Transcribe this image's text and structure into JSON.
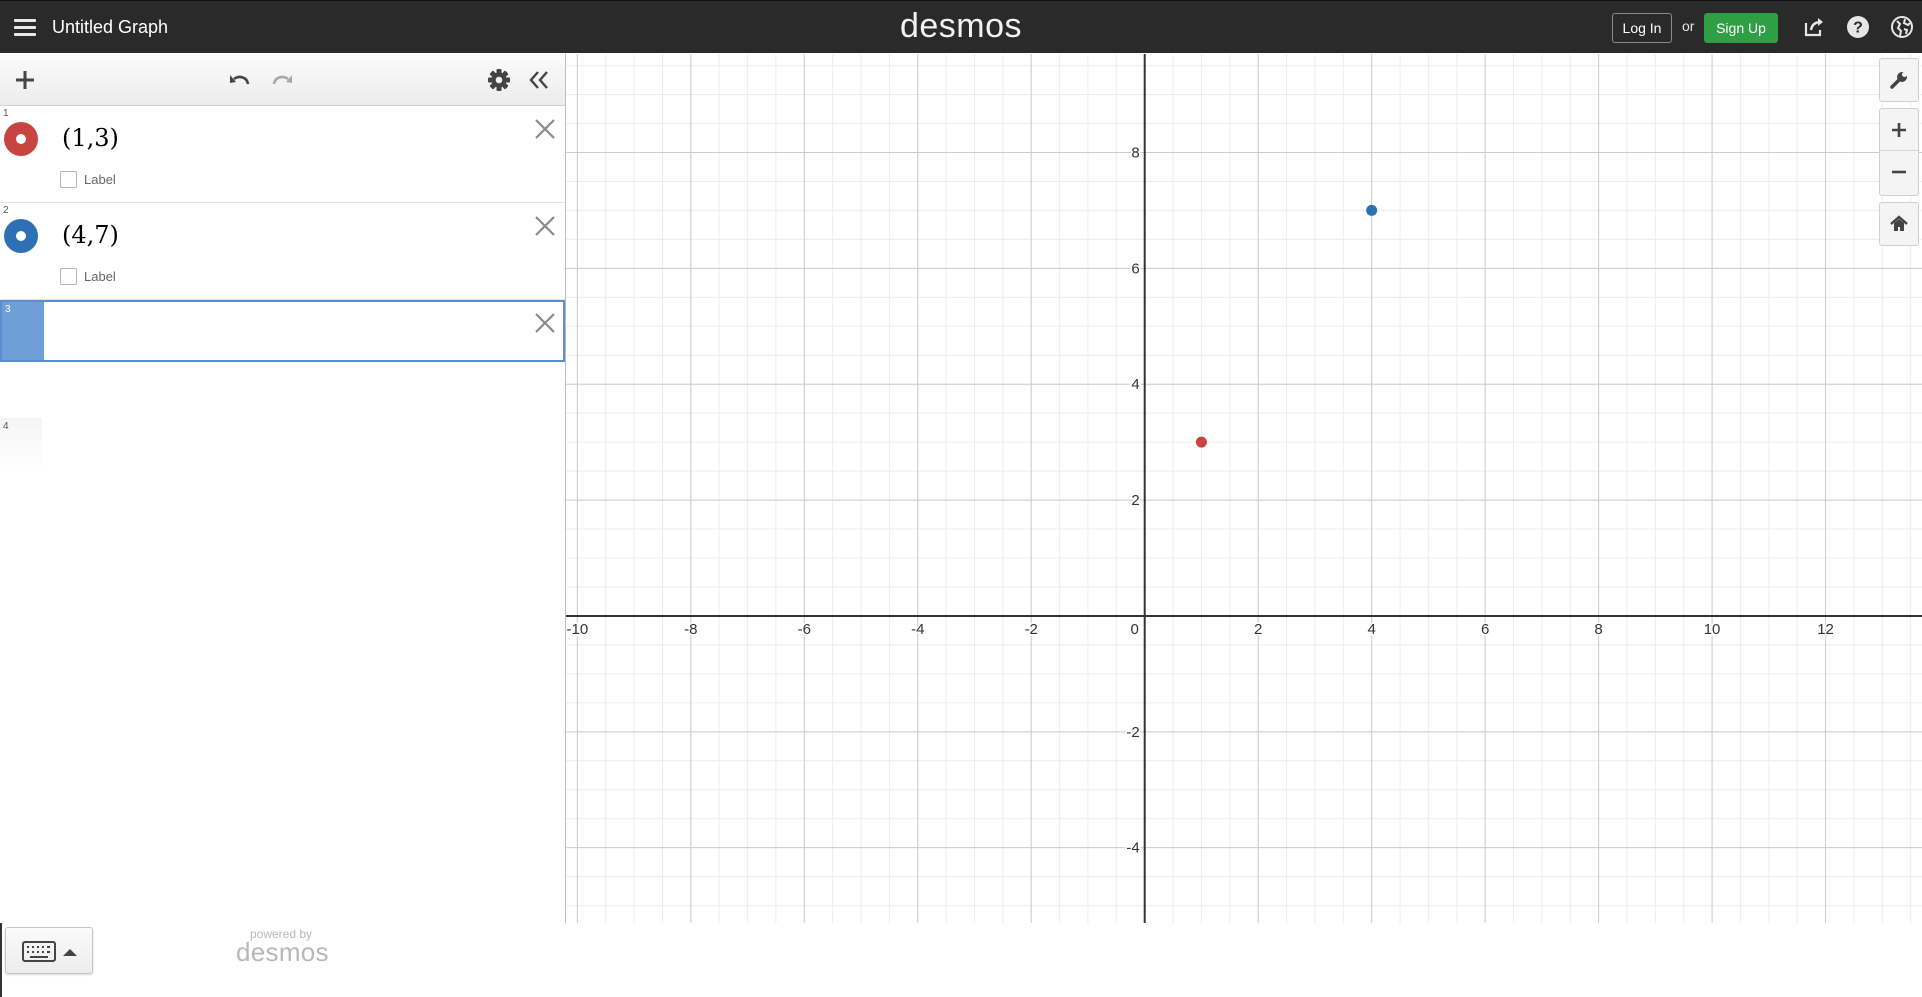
{
  "header": {
    "title": "Untitled Graph",
    "brand": "desmos",
    "login_label": "Log In",
    "or_label": "or",
    "signup_label": "Sign Up",
    "icons": [
      "menu-icon",
      "share-icon",
      "help-icon",
      "language-icon"
    ]
  },
  "expression_panel": {
    "toolbar_icons": [
      "add-icon",
      "undo-icon",
      "redo-icon",
      "settings-gear-icon",
      "collapse-panel-icon"
    ],
    "expressions": [
      {
        "index": "1",
        "latex": "(1,3)",
        "color": "#c74440",
        "label_text": "Label"
      },
      {
        "index": "2",
        "latex": "(4,7)",
        "color": "#2d70b3",
        "label_text": "Label"
      },
      {
        "index": "3",
        "latex": "",
        "active": true
      }
    ],
    "next_row_index": "4",
    "powered_by_small": "powered by",
    "powered_by_brand": "desmos"
  },
  "chart_data": {
    "type": "scatter",
    "xlim": [
      -10.2,
      13.7
    ],
    "ylim": [
      -5.3,
      9.7
    ],
    "x_ticks": [
      "-10",
      "-8",
      "-6",
      "-4",
      "-2",
      "0",
      "2",
      "4",
      "6",
      "8",
      "10",
      "12"
    ],
    "y_ticks": [
      "8",
      "6",
      "4",
      "2",
      "-2",
      "-4"
    ],
    "grid": true,
    "points": [
      {
        "x": 1,
        "y": 3,
        "color": "#c74440"
      },
      {
        "x": 4,
        "y": 7,
        "color": "#2d70b3"
      }
    ]
  },
  "graph_controls": {
    "icons": [
      "wrench-icon",
      "zoom-in-icon",
      "zoom-out-icon",
      "home-icon"
    ]
  }
}
